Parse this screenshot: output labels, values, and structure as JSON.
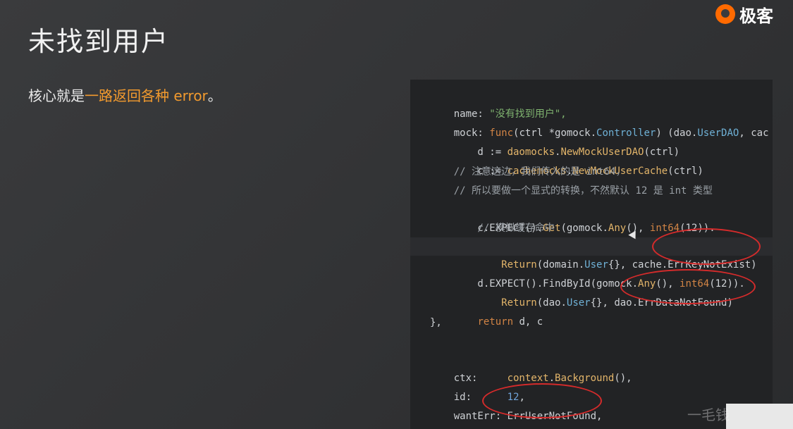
{
  "slide": {
    "title": "未找到用户",
    "desc_prefix": "核心就是",
    "desc_highlight": "一路返回各种 error",
    "desc_suffix": "。"
  },
  "brand": {
    "logo_text": "极客",
    "accent": "#ff6a00"
  },
  "code": {
    "l1": {
      "k": "name: ",
      "v": "\"没有找到用户\",",
      "c": ""
    },
    "l2": {
      "a": "mock: ",
      "b": "func",
      "c": "(ctrl *gomock.",
      "d": "Controller",
      "e": ") (dao.",
      "f": "UserDAO",
      "g": ", cac"
    },
    "l3": {
      "a": "    d := ",
      "b": "daomocks",
      "c": ".",
      "d": "NewMockUserDAO",
      "e": "(ctrl)"
    },
    "l4": {
      "a": "    c := ",
      "b": "cachemocks",
      "c": ".",
      "d": "NewMockUserCache",
      "e": "(ctrl)"
    },
    "l5": "    // 注意这边，我们传入的是 int64，",
    "l6": "    // 所以要做一个显式的转换，不然默认 12 是 int 类型",
    "l7": {
      "a": "    c.EXPECT().",
      "b": "Get",
      "c": "(gomock.",
      "d": "Any",
      "e": "(), ",
      "f": "int64",
      "g": "(12))."
    },
    "l8": "        // 模拟缓存命中",
    "l9": {
      "a": "        ",
      "b": "Return",
      "c": "(domain.",
      "d": "User",
      "e": "{}, cache.ErrKeyNotExist)"
    },
    "l10": {
      "a": "    d.EXPECT().FindById(gomock.",
      "b": "Any",
      "c": "(), ",
      "d": "int64",
      "e": "(12))."
    },
    "l11": {
      "a": "        ",
      "b": "Return",
      "c": "(dao.",
      "d": "User",
      "e": "{}, dao.ErrDataNotFound)"
    },
    "l12": {
      "a": "    ",
      "b": "return",
      "c": " d, c"
    },
    "l13": "},",
    "l14": {
      "a": "ctx:     ",
      "b": "context",
      "c": ".",
      "d": "Background",
      "e": "(),"
    },
    "l15": {
      "a": "id:      ",
      "b": "12",
      "c": ","
    },
    "l16": {
      "a": "wantErr: ",
      "b": "ErrUserNotFound",
      "c": ","
    }
  },
  "watermark": "一毛钱"
}
